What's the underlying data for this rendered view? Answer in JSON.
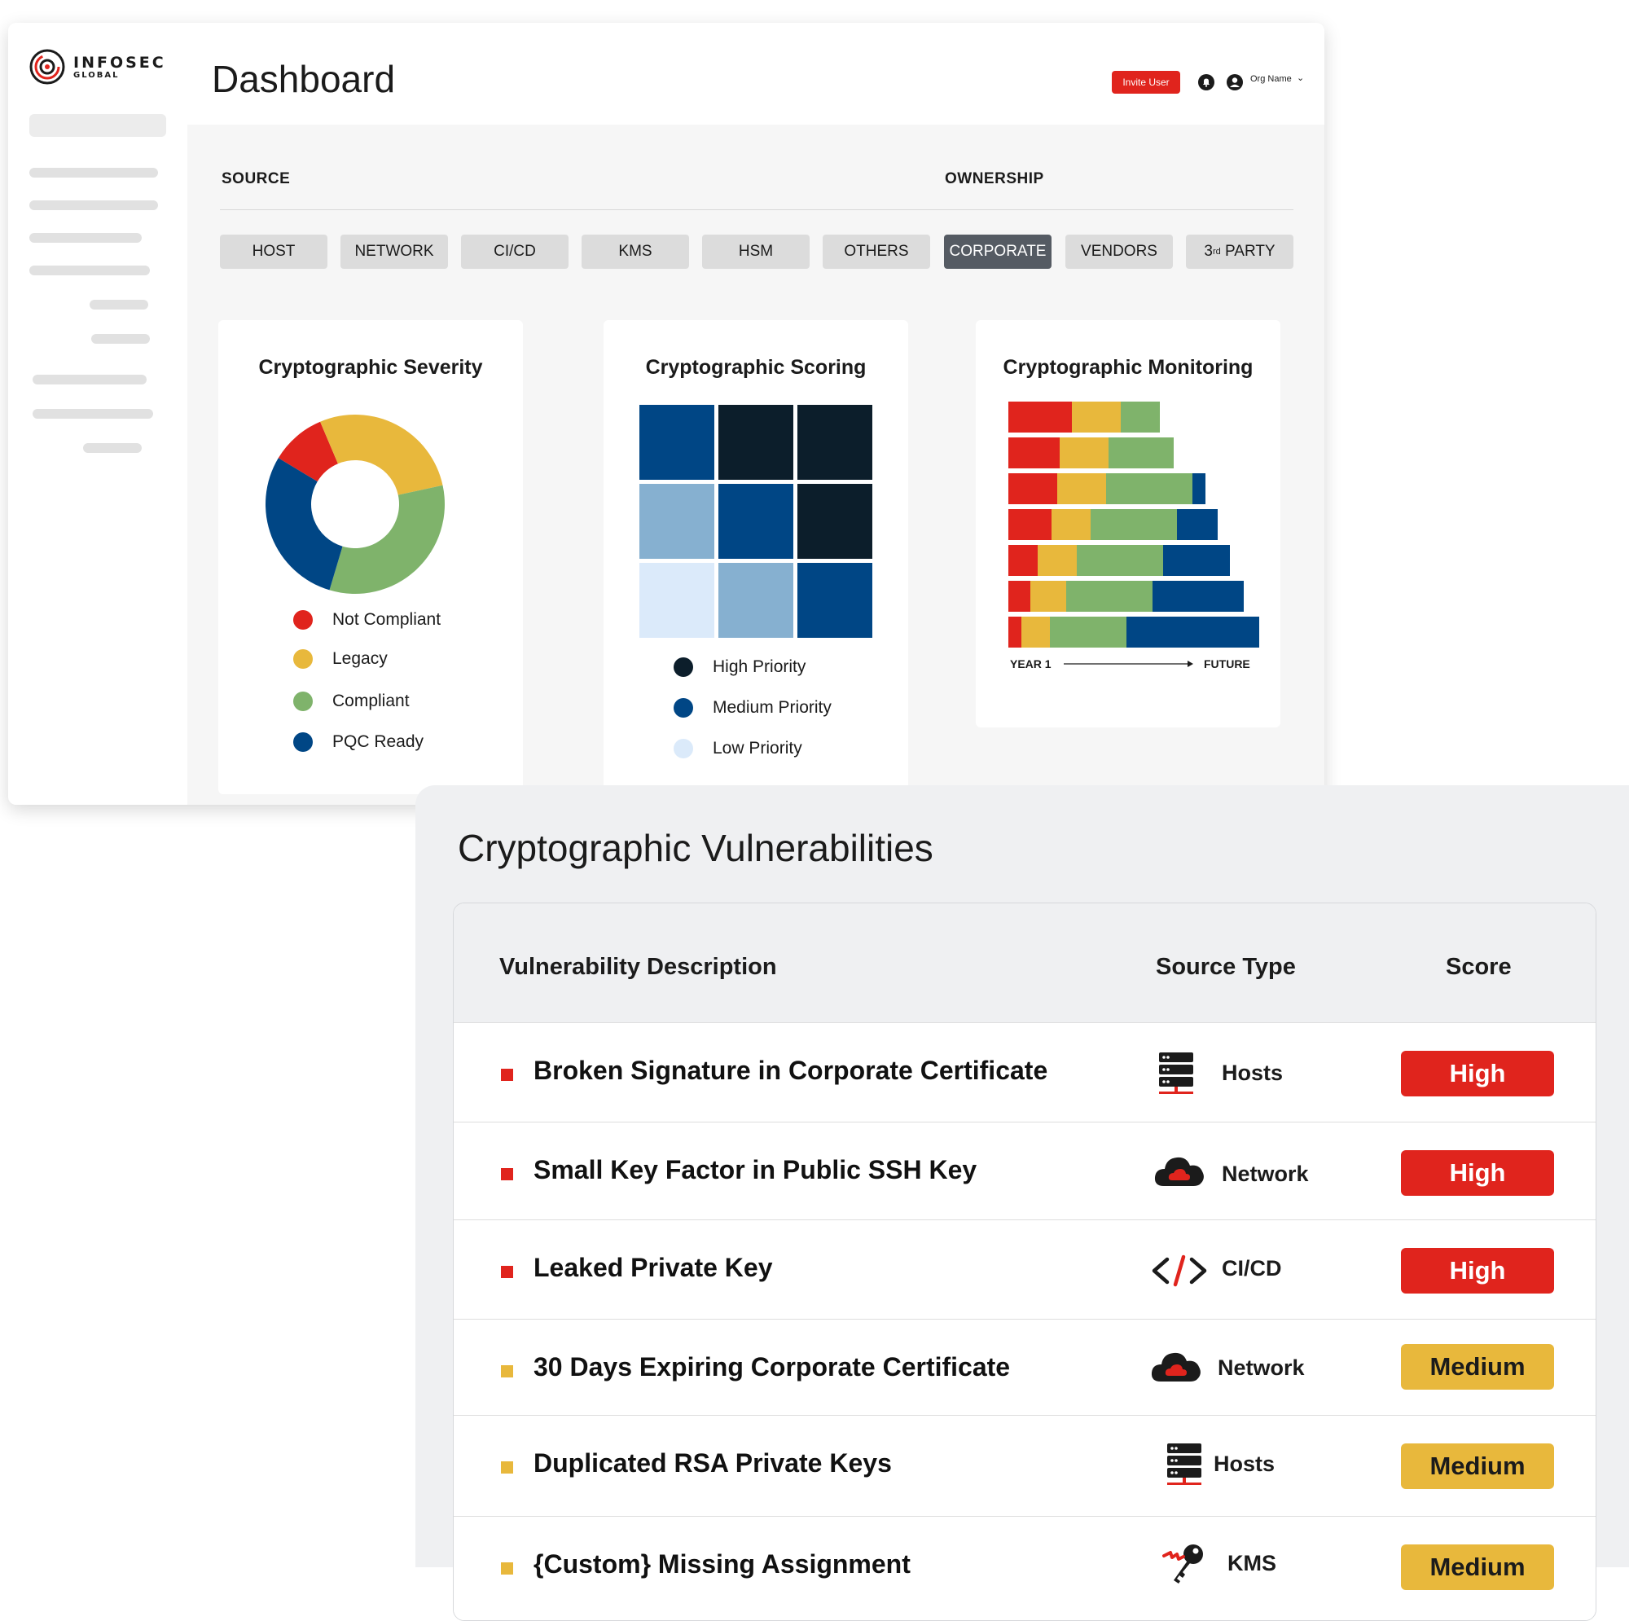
{
  "logo": {
    "line1": "INFOSEC",
    "line2": "GLOBAL"
  },
  "header": {
    "title": "Dashboard",
    "invite_label": "Invite User",
    "org_name": "Org Name",
    "org_chevron": "⌄"
  },
  "filters": {
    "source_label": "SOURCE",
    "ownership_label": "OWNERSHIP",
    "buttons": [
      "HOST",
      "NETWORK",
      "CI/CD",
      "KMS",
      "HSM",
      "OTHERS",
      "CORPORATE",
      "VENDORS"
    ],
    "third_party": {
      "prefix": "3",
      "sup": "rd",
      "suffix": " PARTY"
    },
    "active": "CORPORATE"
  },
  "colors": {
    "red": "#e0241d",
    "yellow": "#e8b83c",
    "green": "#7fb36b",
    "blue": "#004685",
    "navy": "#0c1e2b",
    "light_blue": "#86b0d0",
    "pale_blue": "#dbeafa"
  },
  "severity": {
    "title": "Cryptographic Severity",
    "legend": [
      "Not Compliant",
      "Legacy",
      "Compliant",
      "PQC Ready"
    ]
  },
  "scoring": {
    "title": "Cryptographic Scoring",
    "legend": [
      "High Priority",
      "Medium Priority",
      "Low Priority"
    ]
  },
  "monitoring": {
    "title": "Cryptographic Monitoring",
    "x_start": "YEAR 1",
    "x_end": "FUTURE"
  },
  "chart_data": [
    {
      "type": "pie",
      "title": "Cryptographic Severity",
      "labels": [
        "Not Compliant",
        "Legacy",
        "Compliant",
        "PQC Ready"
      ],
      "values": [
        10,
        28,
        33,
        29
      ],
      "colors": [
        "#e0241d",
        "#e8b83c",
        "#7fb36b",
        "#004685"
      ]
    },
    {
      "type": "heatmap",
      "title": "Cryptographic Scoring",
      "legend": [
        "High Priority",
        "Medium Priority",
        "Low Priority"
      ],
      "cells": [
        [
          "Medium Priority",
          "High Priority",
          "High Priority"
        ],
        [
          "Low-Medium Priority",
          "Medium Priority",
          "High Priority"
        ],
        [
          "Low Priority",
          "Low-Medium Priority",
          "Medium Priority"
        ]
      ]
    },
    {
      "type": "bar",
      "title": "Cryptographic Monitoring",
      "stacked": true,
      "orientation": "horizontal",
      "xlabel": "YEAR 1 → FUTURE",
      "series": [
        {
          "color": "#e0241d",
          "values": [
            78,
            63,
            60,
            53,
            36,
            27,
            16
          ]
        },
        {
          "color": "#e8b83c",
          "values": [
            60,
            60,
            60,
            48,
            48,
            44,
            35
          ]
        },
        {
          "color": "#7fb36b",
          "values": [
            48,
            80,
            106,
            106,
            106,
            106,
            94
          ]
        },
        {
          "color": "#004685",
          "values": [
            0,
            0,
            16,
            50,
            82,
            112,
            163
          ]
        }
      ]
    }
  ],
  "vulnerabilities": {
    "title": "Cryptographic Vulnerabilities",
    "columns": [
      "Vulnerability Description",
      "Source Type",
      "Score"
    ],
    "rows": [
      {
        "desc": "Broken Signature in Corporate Certificate",
        "source": "Hosts",
        "icon": "server-icon",
        "score": "High",
        "level": "high"
      },
      {
        "desc": "Small Key Factor in Public SSH Key",
        "source": "Network",
        "icon": "cloud-icon",
        "score": "High",
        "level": "high"
      },
      {
        "desc": "Leaked Private Key",
        "source": "CI/CD",
        "icon": "code-icon",
        "score": "High",
        "level": "high"
      },
      {
        "desc": "30 Days Expiring Corporate Certificate",
        "source": "Network",
        "icon": "cloud-icon",
        "score": "Medium",
        "level": "med"
      },
      {
        "desc": "Duplicated RSA Private Keys",
        "source": "Hosts",
        "icon": "server-icon",
        "score": "Medium",
        "level": "med"
      },
      {
        "desc": "{Custom} Missing Assignment",
        "source": "KMS",
        "icon": "key-icon",
        "score": "Medium",
        "level": "med"
      }
    ]
  }
}
